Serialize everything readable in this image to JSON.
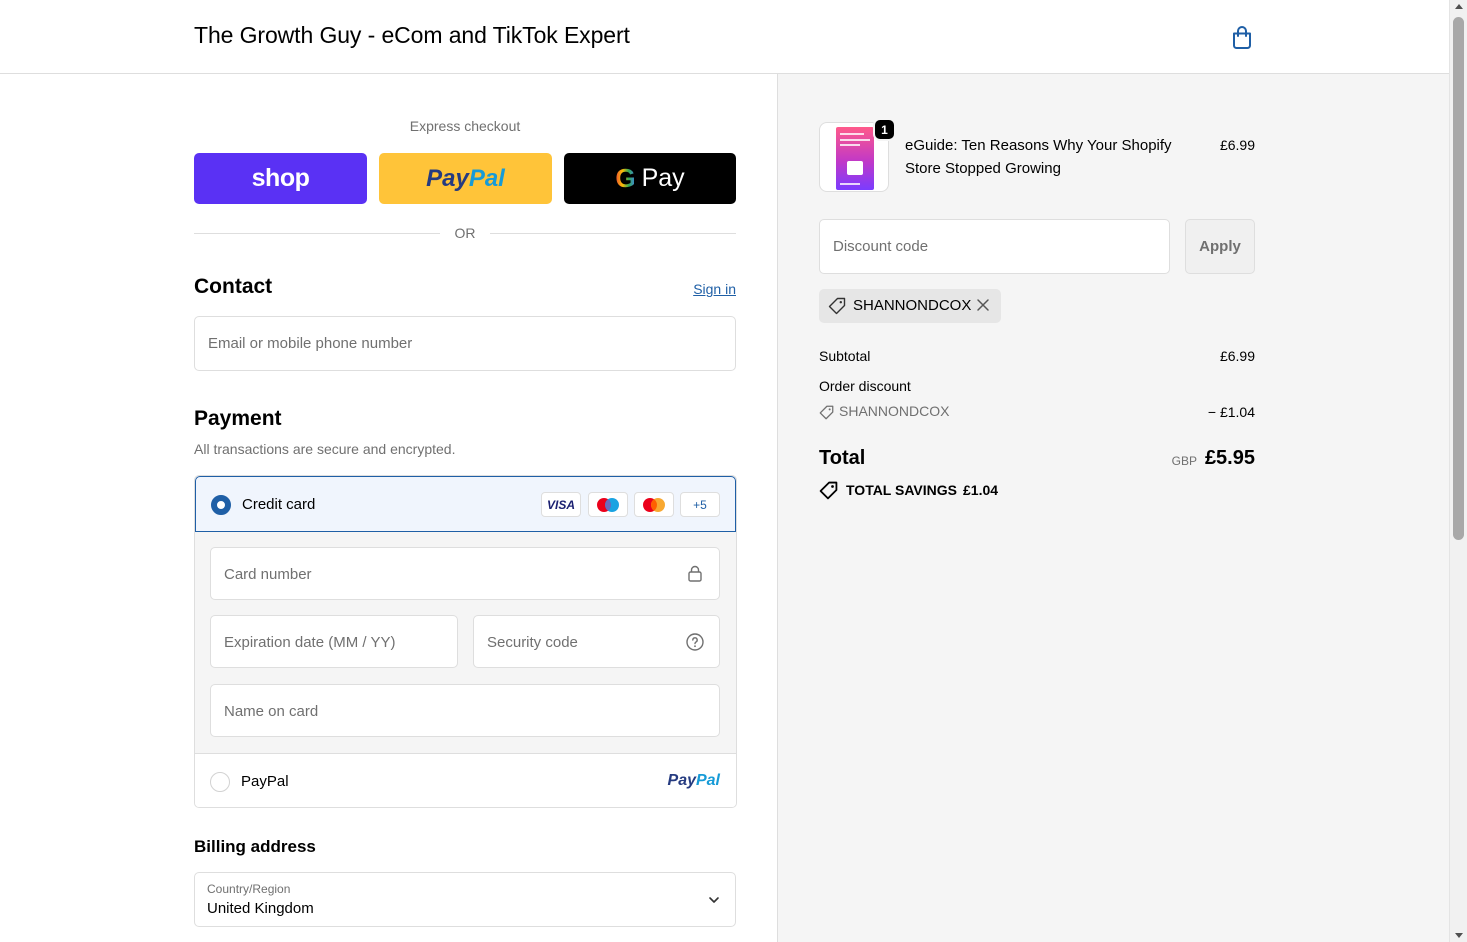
{
  "header": {
    "shop_title": "The Growth Guy - eCom and TikTok Expert",
    "cart_icon": "shopping-bag-icon"
  },
  "express": {
    "label": "Express checkout",
    "shop_pay": "shop",
    "paypal_a": "Pay",
    "paypal_b": "Pal",
    "gpay_g": "G",
    "gpay_label": "Pay",
    "or": "OR"
  },
  "contact": {
    "title": "Contact",
    "sign_in": "Sign in",
    "email_placeholder": "Email or mobile phone number"
  },
  "payment": {
    "title": "Payment",
    "subtitle": "All transactions are secure and encrypted.",
    "credit_card_label": "Credit card",
    "card_brands": {
      "visa": "VISA",
      "more": "+5"
    },
    "card_number_placeholder": "Card number",
    "expiration_placeholder": "Expiration date (MM / YY)",
    "security_code_placeholder": "Security code",
    "name_on_card_placeholder": "Name on card",
    "paypal_label": "PayPal",
    "paypal_logo_a": "Pay",
    "paypal_logo_b": "Pal"
  },
  "billing": {
    "title": "Billing address",
    "country_label": "Country/Region",
    "country_value": "United Kingdom"
  },
  "summary": {
    "product": {
      "quantity": "1",
      "name": "eGuide: Ten Reasons Why Your Shopify Store Stopped Growing",
      "price": "£6.99"
    },
    "discount_placeholder": "Discount code",
    "apply_label": "Apply",
    "applied_code": "SHANNONDCOX",
    "subtotal_label": "Subtotal",
    "subtotal_value": "£6.99",
    "order_discount_label": "Order discount",
    "discount_code": "SHANNONDCOX",
    "discount_value": "− £1.04",
    "total_label": "Total",
    "currency": "GBP",
    "total_value": "£5.95",
    "savings_label": "TOTAL SAVINGS",
    "savings_value": "£1.04"
  },
  "colors": {
    "accent": "#1f5fa6",
    "shop_pay": "#5a31f4",
    "paypal_yellow": "#ffc439",
    "panel_bg": "#f5f5f5"
  }
}
